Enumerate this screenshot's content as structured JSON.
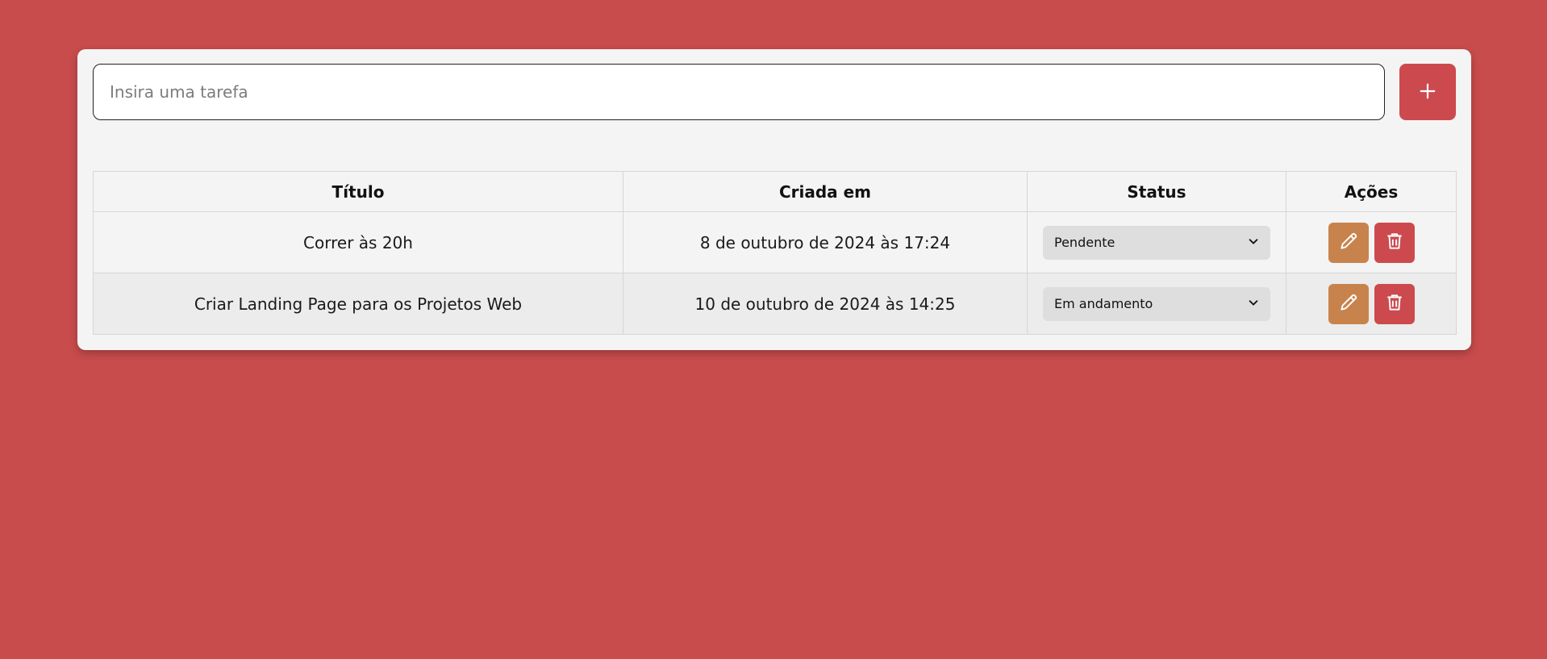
{
  "colors": {
    "background": "#c84c4c",
    "card": "#f4f4f4",
    "accent_red": "#cc4a4e",
    "edit_orange": "#c8834c"
  },
  "new_task": {
    "placeholder": "Insira uma tarefa",
    "value": "",
    "add_icon": "plus-icon"
  },
  "table": {
    "headers": {
      "title": "Título",
      "created": "Criada em",
      "status": "Status",
      "actions": "Ações"
    },
    "rows": [
      {
        "title": "Correr às 20h",
        "created": "8 de outubro de 2024 às 17:24",
        "status": "Pendente",
        "edit_icon": "pencil-icon",
        "delete_icon": "trash-icon"
      },
      {
        "title": "Criar Landing Page para os Projetos Web",
        "created": "10 de outubro de 2024 às 14:25",
        "status": "Em andamento",
        "edit_icon": "pencil-icon",
        "delete_icon": "trash-icon"
      }
    ]
  }
}
